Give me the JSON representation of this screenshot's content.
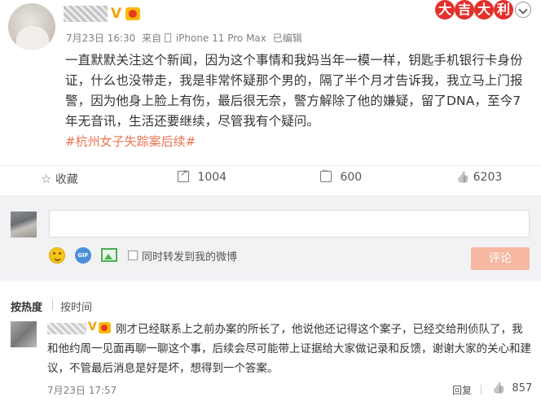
{
  "post": {
    "vip_mark": "V",
    "meta": {
      "date": "7月23日 16:30",
      "source_prefix": "来自",
      "device": "iPhone 11 Pro Max",
      "edited": "已编辑"
    },
    "text": "一直默默关注这个新闻，因为这个事情和我妈当年一模一样，钥匙手机银行卡身份证，什么也没带走，我是非常怀疑那个男的，隔了半个月才告诉我，我立马上门报警，因为他身上脸上有伤，最后很无奈，警方解除了他的嫌疑，留了DNA，至今7年无音讯，生活还要继续，尽管我有个疑问。",
    "topic": "#杭州女子失踪案后续#",
    "luck_badge": [
      "大",
      "吉",
      "大",
      "利"
    ]
  },
  "actions": {
    "favorite": "收藏",
    "repost": "1004",
    "comment": "600",
    "like": "6203"
  },
  "comment_box": {
    "gif_label": "GIF",
    "repost_option": "同时转发到我的微博",
    "submit": "评论"
  },
  "sort": {
    "hot": "按热度",
    "time": "按时间"
  },
  "comment": {
    "vip_mark": "V",
    "text": "刚才已经联系上之前办案的所长了，他说他还记得这个案子，已经交给刑侦队了，我和他约周一见面再聊一聊这个事，后续会尽可能带上证据给大家做记录和反馈，谢谢大家的关心和建议，不管最后消息是好是坏，想得到一个答案。",
    "time": "7月23日 17:57",
    "reply": "回复",
    "likes": "857"
  }
}
